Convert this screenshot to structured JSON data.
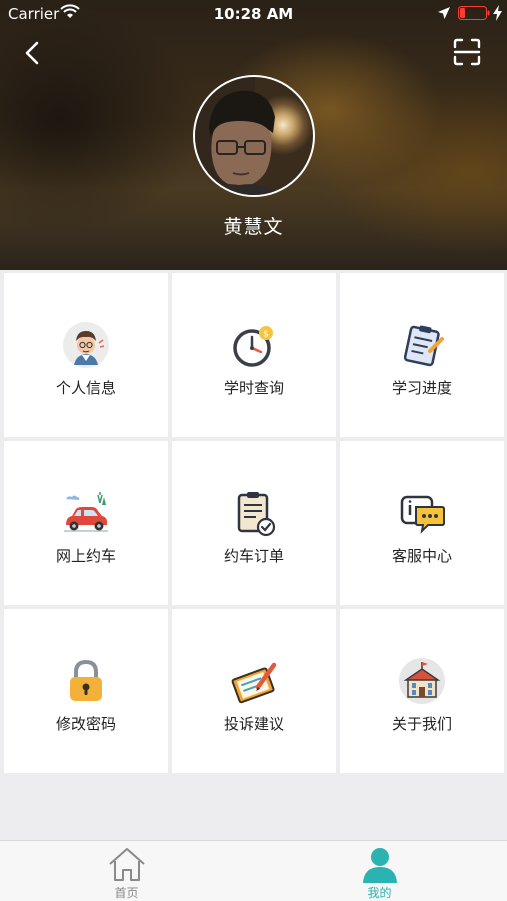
{
  "status_bar": {
    "carrier": "Carrier",
    "time": "10:28 AM"
  },
  "header": {
    "back_icon": "chevron-left-icon",
    "scan_icon": "scan-icon",
    "user_name": "黄慧文"
  },
  "menu": [
    {
      "label": "个人信息",
      "icon": "personal-info-icon"
    },
    {
      "label": "学时查询",
      "icon": "clock-icon"
    },
    {
      "label": "学习进度",
      "icon": "clipboard-progress-icon"
    },
    {
      "label": "网上约车",
      "icon": "car-icon"
    },
    {
      "label": "约车订单",
      "icon": "order-icon"
    },
    {
      "label": "客服中心",
      "icon": "chat-icon"
    },
    {
      "label": "修改密码",
      "icon": "lock-icon"
    },
    {
      "label": "投诉建议",
      "icon": "pencil-note-icon"
    },
    {
      "label": "关于我们",
      "icon": "building-icon"
    }
  ],
  "tab_bar": {
    "items": [
      {
        "label": "首页",
        "icon": "home-icon"
      },
      {
        "label": "我的",
        "icon": "user-icon"
      }
    ],
    "active_color": "#2ab3b0",
    "inactive_color": "#8a8a8a"
  }
}
